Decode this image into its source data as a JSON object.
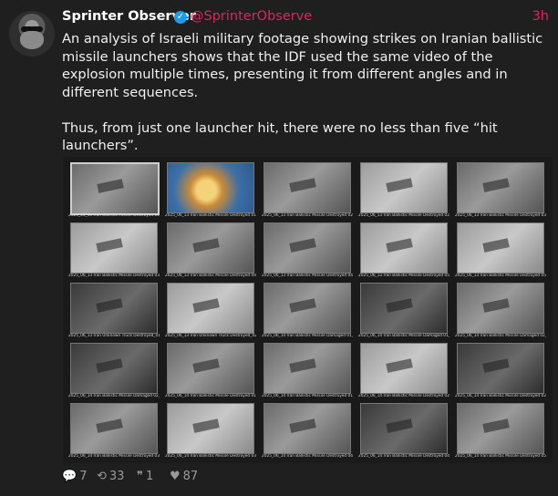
{
  "post": {
    "author_name": "Sprinter Observer",
    "author_handle": "@SprinterObserve",
    "verified_icon": "verified-check-icon",
    "time": "3h",
    "paragraphs": [
      "An analysis of Israeli military footage showing strikes on Iranian ballistic missile launchers shows that the IDF used the same video of the explosion multiple times, presenting it from different angles and in different sequences.",
      "Thus, from just one launcher hit, there were no less than five “hit launchers”."
    ]
  },
  "media": {
    "thumbnails": [
      {
        "caption": "2025_06_13 Iran Ballistic Missile Destroyed 01_01",
        "style": "selected"
      },
      {
        "caption": "2025_06_13 Iran Ballistic Missile Destroyed 01_02",
        "style": "color"
      },
      {
        "caption": "2025_06_13 Iran Ballistic Missile Destroyed 02_01",
        "style": "normal"
      },
      {
        "caption": "2025_06_13 Iran Ballistic Missile Destroyed 02_02",
        "style": "light"
      },
      {
        "caption": "2025_06_13 Iran Ballistic Missile Destroyed 03_01",
        "style": "normal"
      },
      {
        "caption": "2025_06_13 Iran Ballistic Missile Destroyed 03_02",
        "style": "light"
      },
      {
        "caption": "2025_06_13 Iran Ballistic Missile Destroyed 04_01",
        "style": "normal"
      },
      {
        "caption": "2025_06_13 Iran Ballistic Missile Destroyed 04_02",
        "style": "normal"
      },
      {
        "caption": "2025_06_13 Iran Ballistic Missile Destroyed 05_01",
        "style": "light"
      },
      {
        "caption": "2025_06_13 Iran Ballistic Missile Destroyed 05_02",
        "style": "light"
      },
      {
        "caption": "2025_06_13 Iran Unknown Truck Destroyed_01",
        "style": "dark"
      },
      {
        "caption": "2025_06_13 Iran Unknown Truck Destroyed_02",
        "style": "light"
      },
      {
        "caption": "2025_06_14 Iran Ballistic Missile Damaged 01_01",
        "style": "normal"
      },
      {
        "caption": "2025_06_14 Iran Ballistic Missile Damaged 01_02",
        "style": "dark"
      },
      {
        "caption": "2025_06_14 Iran Ballistic Missile Damaged 02_01",
        "style": "normal"
      },
      {
        "caption": "2025_06_14 Iran Ballistic Missile Damaged 02_02",
        "style": "dark"
      },
      {
        "caption": "2025_06_14 Iran Ballistic Missile Destroyed 01_01",
        "style": "normal"
      },
      {
        "caption": "2025_06_14 Iran Ballistic Missile Destroyed 01_02",
        "style": "normal"
      },
      {
        "caption": "2025_06_14 Iran Ballistic Missile Destroyed 02_01",
        "style": "light"
      },
      {
        "caption": "2025_06_14 Iran Ballistic Missile Destroyed 02_02",
        "style": "dark"
      },
      {
        "caption": "2025_06_14 Iran Ballistic Missile Destroyed 03_01",
        "style": "normal"
      },
      {
        "caption": "2025_06_14 Iran Ballistic Missile Destroyed 03_02",
        "style": "light"
      },
      {
        "caption": "2025_06_14 Iran Ballistic Missile Destroyed 04_01",
        "style": "normal"
      },
      {
        "caption": "2025_06_14 Iran Ballistic Missile Destroyed 04_02",
        "style": "dark"
      },
      {
        "caption": "2025_06_14 Iran Ballistic Missile Destroyed 05_01",
        "style": "normal"
      }
    ]
  },
  "actions": {
    "reply": {
      "icon": "speech-bubble-icon",
      "glyph": "💬",
      "count": "7"
    },
    "repost": {
      "icon": "repost-icon",
      "glyph": "⟲",
      "count": "33"
    },
    "quote": {
      "icon": "quote-icon",
      "glyph": "❞",
      "count": "1"
    },
    "like": {
      "icon": "heart-icon",
      "glyph": "♥",
      "count": "87"
    }
  },
  "colors": {
    "background": "#1f1f1f",
    "accent_handle": "#e0245e",
    "verified": "#1d9bf0",
    "muted": "#9a9a9a"
  }
}
